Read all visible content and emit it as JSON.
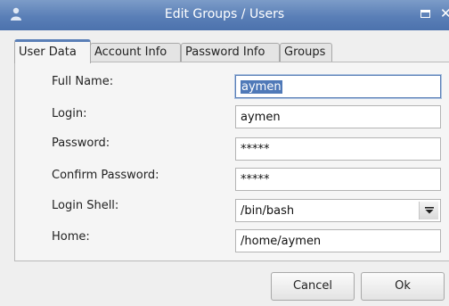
{
  "window": {
    "title": "Edit Groups / Users"
  },
  "tabs": [
    {
      "label": "User Data",
      "active": true
    },
    {
      "label": "Account Info",
      "active": false
    },
    {
      "label": "Password Info",
      "active": false
    },
    {
      "label": "Groups",
      "active": false
    }
  ],
  "form": {
    "full_name": {
      "label": "Full Name:",
      "value": "aymen"
    },
    "login": {
      "label": "Login:",
      "value": "aymen"
    },
    "password": {
      "label": "Password:",
      "value": "*****"
    },
    "confirm_password": {
      "label": "Confirm Password:",
      "value": "*****"
    },
    "login_shell": {
      "label": "Login Shell:",
      "value": "/bin/bash"
    },
    "home": {
      "label": "Home:",
      "value": "/home/aymen"
    }
  },
  "buttons": {
    "cancel": "Cancel",
    "ok": "Ok"
  },
  "icons": {
    "app": "user-icon",
    "maximize": "maximize-icon",
    "close": "close-icon",
    "dropdown": "chevron-down-icon"
  },
  "colors": {
    "titlebar": "#5a7fb7",
    "selection": "#4f79b8",
    "active_tab_accent": "#5a7fb7"
  }
}
